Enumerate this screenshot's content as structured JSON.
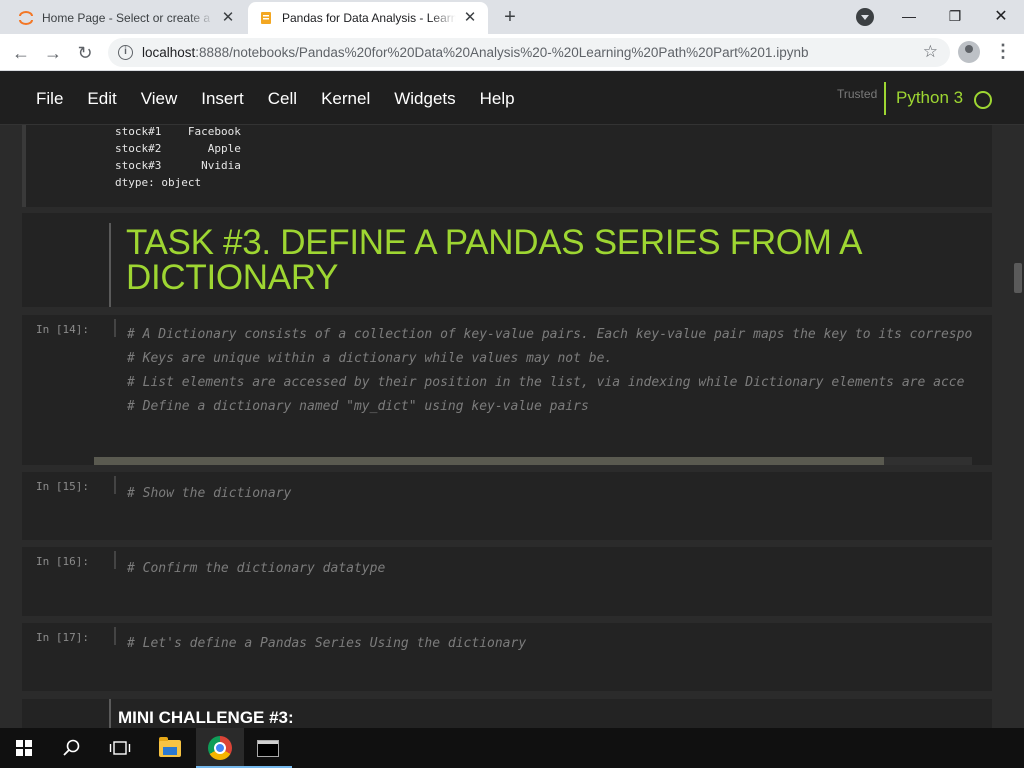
{
  "browser": {
    "tabs": [
      {
        "title": "Home Page - Select or create a notebook",
        "active": false
      },
      {
        "title": "Pandas for Data Analysis - Learning Path",
        "active": true
      }
    ],
    "new_tab": "+",
    "url_host": "localhost",
    "url_path": ":8888/notebooks/Pandas%20for%20Data%20Analysis%20-%20Learning%20Path%20Part%201.ipynb",
    "window_controls": {
      "minimize": "—",
      "restore": "❐",
      "close": "✕"
    }
  },
  "jupyter": {
    "menu": [
      "File",
      "Edit",
      "View",
      "Insert",
      "Cell",
      "Kernel",
      "Widgets",
      "Help"
    ],
    "trusted": "Trusted",
    "kernel": "Python 3",
    "accent": "#9ed632"
  },
  "notebook": {
    "output": {
      "lines": [
        "stock#1    Facebook",
        "stock#2       Apple",
        "stock#3      Nvidia",
        "dtype: object"
      ]
    },
    "markdown_heading": "TASK #3. DEFINE A PANDAS SERIES FROM A DICTIONARY",
    "cells": [
      {
        "prompt": "In [14]:",
        "lines": [
          "# A Dictionary consists of a collection of key-value pairs. Each key-value pair maps the key to its correspo",
          "# Keys are unique within a dictionary while values may not be.",
          "# List elements are accessed by their position in the list, via indexing while Dictionary elements are acce",
          "# Define a dictionary named \"my_dict\" using key-value pairs"
        ]
      },
      {
        "prompt": "In [15]:",
        "lines": [
          "# Show the dictionary"
        ]
      },
      {
        "prompt": "In [16]:",
        "lines": [
          "# Confirm the dictionary datatype"
        ]
      },
      {
        "prompt": "In [17]:",
        "lines": [
          "# Let's define a Pandas Series Using the dictionary"
        ]
      }
    ],
    "mini_challenge": "MINI CHALLENGE #3:"
  },
  "taskbar": {
    "items": [
      "windows-start",
      "search",
      "task-view",
      "file-explorer",
      "chrome",
      "terminal"
    ]
  }
}
